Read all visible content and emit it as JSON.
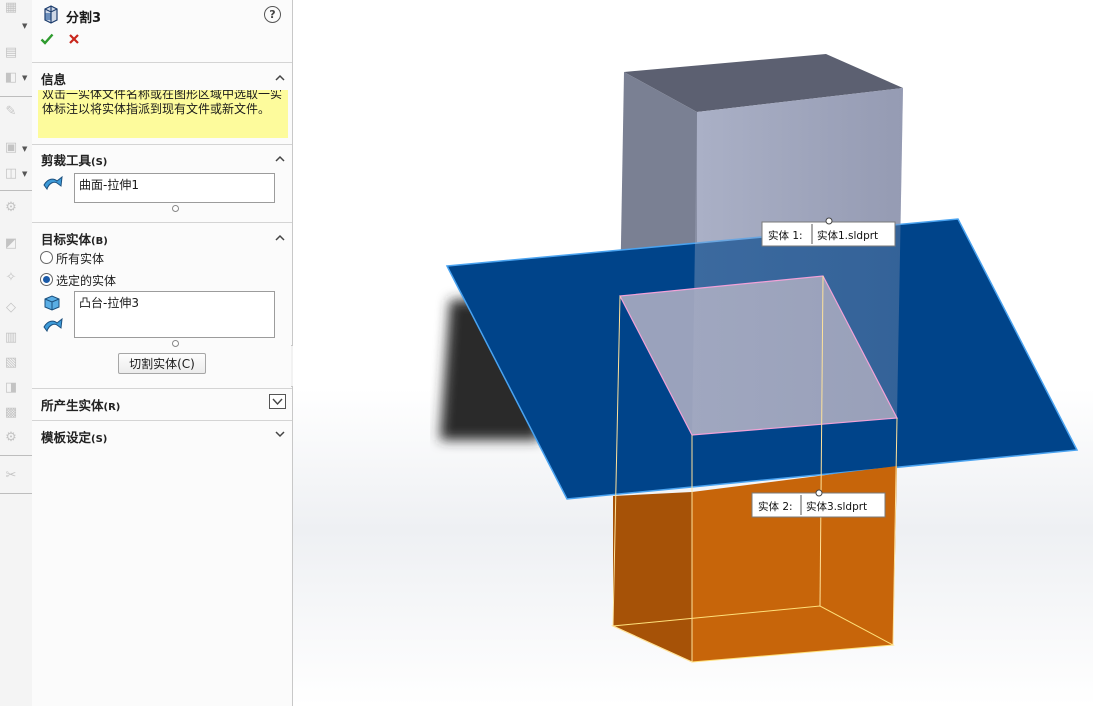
{
  "feature": {
    "title": "分割3"
  },
  "info": {
    "title": "信息",
    "message": "双击一实体文件名称或在图形区域中选取一实体标注以将实体指派到现有文件或新文件。"
  },
  "trim_tool": {
    "title": "剪裁工具",
    "shortcut": "(S)",
    "value": "曲面-拉伸1"
  },
  "target_bodies": {
    "title": "目标实体",
    "shortcut": "(B)",
    "options": [
      "所有实体",
      "选定的实体"
    ],
    "selected_option": "选定的实体",
    "value": "凸台-拉伸3",
    "cut_button": "切割实体(C)"
  },
  "resulting_bodies": {
    "title": "所产生实体",
    "shortcut": "(R)"
  },
  "template_settings": {
    "title": "模板设定",
    "shortcut": "(S)"
  },
  "callouts": [
    {
      "label": "实体  1:",
      "file": "实体1.sldprt"
    },
    {
      "label": "实体  2:",
      "file": "实体3.sldprt"
    }
  ],
  "colors": {
    "info_background": "#fdfb9c",
    "plane": "#00448a",
    "upper_body": "#9aa0b8",
    "lower_body": "#c06208",
    "selected_radio": "#1a5aa8"
  }
}
